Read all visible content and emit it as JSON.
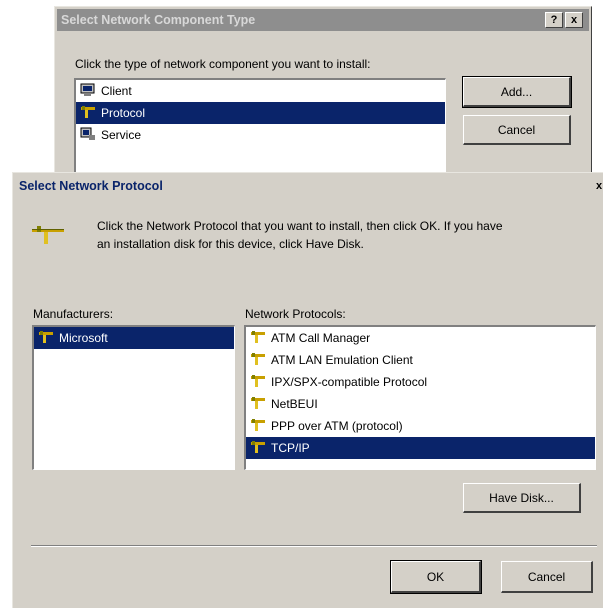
{
  "component_dialog": {
    "title": "Select Network Component Type",
    "help_button": "?",
    "close_button": "x",
    "instruction": "Click the type of network component you want to install:",
    "items": [
      {
        "label": "Client",
        "icon": "client-icon",
        "selected": false
      },
      {
        "label": "Protocol",
        "icon": "protocol-icon",
        "selected": true
      },
      {
        "label": "Service",
        "icon": "service-icon",
        "selected": false
      }
    ],
    "add_label": "Add...",
    "cancel_label": "Cancel"
  },
  "protocol_dialog": {
    "title": "Select Network Protocol",
    "close_button": "x",
    "instruction_line1": "Click the Network Protocol that you want to install, then click OK. If you have",
    "instruction_line2": "an installation disk for this device, click Have Disk.",
    "manufacturers_label": "Manufacturers:",
    "manufacturers": [
      {
        "label": "Microsoft",
        "selected": true
      }
    ],
    "protocols_label": "Network Protocols:",
    "protocols": [
      {
        "label": "ATM Call Manager",
        "selected": false
      },
      {
        "label": "ATM LAN Emulation Client",
        "selected": false
      },
      {
        "label": "IPX/SPX-compatible Protocol",
        "selected": false
      },
      {
        "label": "NetBEUI",
        "selected": false
      },
      {
        "label": "PPP over ATM (protocol)",
        "selected": false
      },
      {
        "label": "TCP/IP",
        "selected": true
      }
    ],
    "have_disk_label": "Have Disk...",
    "ok_label": "OK",
    "cancel_label": "Cancel"
  },
  "colors": {
    "dialog_face": "#d4d0c8",
    "selection": "#0a246a",
    "title_text": "#0a246a",
    "inactive_title": "#8e8e8e"
  }
}
